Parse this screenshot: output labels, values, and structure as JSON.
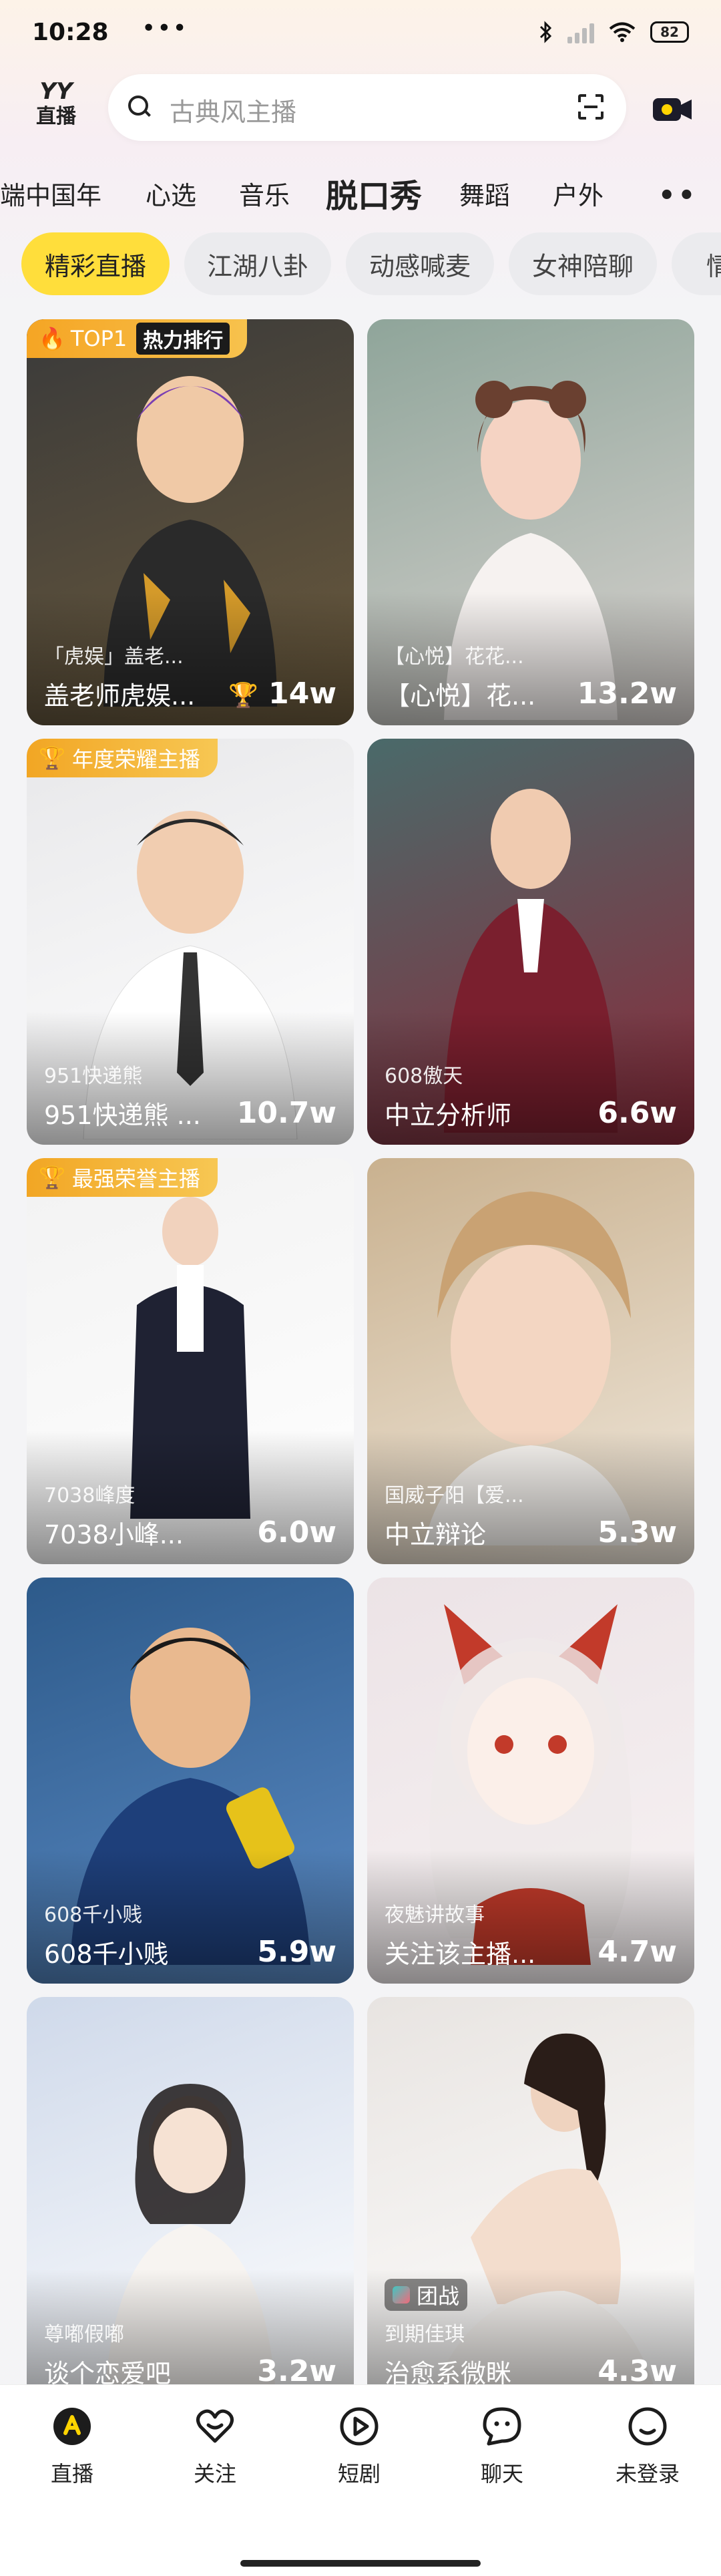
{
  "status_bar": {
    "time": "10:28",
    "dots": "•••",
    "battery": "82"
  },
  "top": {
    "logo_top": "YY",
    "logo_bottom": "直播",
    "search_placeholder": "古典风主播"
  },
  "tabs": [
    "端中国年",
    "心选",
    "音乐",
    "脱口秀",
    "舞蹈",
    "户外"
  ],
  "active_tab": "脱口秀",
  "more_label": "••",
  "chips": [
    "精彩直播",
    "江湖八卦",
    "动感喊麦",
    "女神陪聊",
    "情感"
  ],
  "cards": [
    {
      "sub": "「虎娱」盖老...",
      "name": "盖老师虎娱...",
      "hot": "14w",
      "badge": "TOP1",
      "rank": "热力排行",
      "colors": [
        "#3a3a3a",
        "#6b5a3c"
      ]
    },
    {
      "sub": "【心悦】花花...",
      "name": "【心悦】花...",
      "hot": "13.2w",
      "colors": [
        "#8fa59a",
        "#d8d2cf"
      ]
    },
    {
      "sub": "951快递熊",
      "name": "951快递熊 ...",
      "hot": "10.7w",
      "badge": "年度荣耀主播",
      "colors": [
        "#e8e8ea",
        "#ffffff"
      ]
    },
    {
      "sub": "608傲天",
      "name": "中立分析师",
      "hot": "6.6w",
      "colors": [
        "#4a6a6a",
        "#8a2a3a"
      ]
    },
    {
      "sub": "7038峰度",
      "name": "7038小峰...",
      "hot": "6.0w",
      "badge": "最强荣誉主播",
      "colors": [
        "#f2f2f2",
        "#ffffff"
      ]
    },
    {
      "sub": "国威子阳【爱...",
      "name": "中立辩论",
      "hot": "5.3w",
      "colors": [
        "#c9b18f",
        "#f0e8dc"
      ]
    },
    {
      "sub": "608千小贱",
      "name": "608千小贱",
      "hot": "5.9w",
      "colors": [
        "#2d5a8a",
        "#5a8ac4"
      ]
    },
    {
      "sub": "夜魅讲故事",
      "name": "关注该主播...",
      "hot": "4.7w",
      "colors": [
        "#ece3e6",
        "#f7f2f3"
      ]
    },
    {
      "sub": "尊嘟假嘟",
      "name": "谈个恋爱吧",
      "hot": "3.2w",
      "colors": [
        "#cfd9ea",
        "#ffffff"
      ]
    },
    {
      "sub": "到期佳琪",
      "name": "治愈系微眯",
      "hot": "4.3w",
      "tag": "团战",
      "colors": [
        "#e8e4e1",
        "#ffffff"
      ]
    }
  ],
  "bottom_nav": [
    "直播",
    "关注",
    "短剧",
    "聊天",
    "未登录"
  ]
}
